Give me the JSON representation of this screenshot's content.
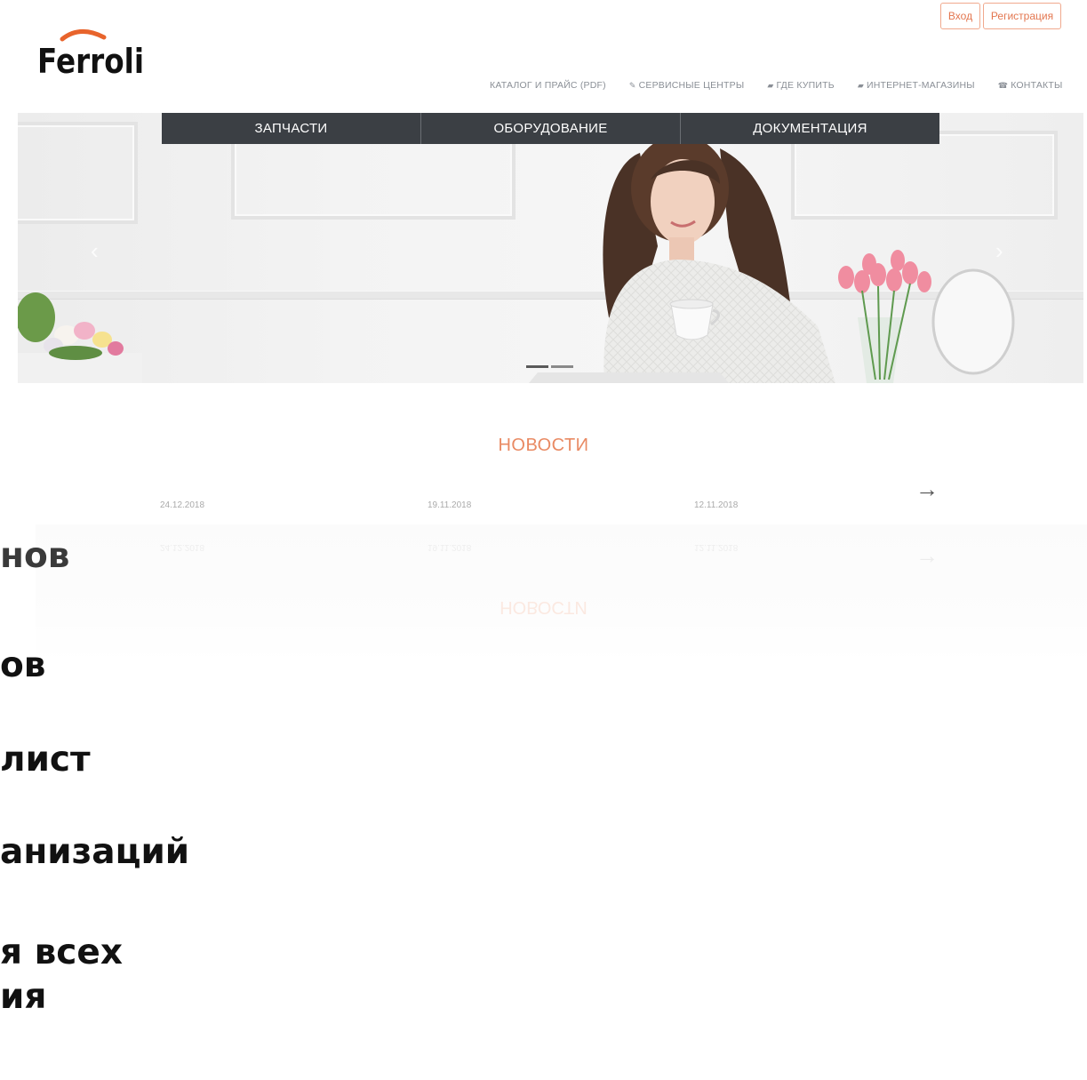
{
  "auth": {
    "login": "Вход",
    "register": "Регистрация"
  },
  "logo": {
    "text": "Ferroli",
    "arc_color": "#e8642c"
  },
  "topnav": [
    {
      "label": "КАТАЛОГ И ПРАЙС (PDF)",
      "icon": ""
    },
    {
      "label": "СЕРВИСНЫЕ ЦЕНТРЫ",
      "icon": "wrench-icon"
    },
    {
      "label": "ГДЕ КУПИТЬ",
      "icon": "cart-icon"
    },
    {
      "label": "ИНТЕРНЕТ-МАГАЗИНЫ",
      "icon": "cart-icon"
    },
    {
      "label": "КОНТАКТЫ",
      "icon": "phone-icon"
    }
  ],
  "catnav": [
    "ЗАПЧАСТИ",
    "ОБОРУДОВАНИЕ",
    "ДОКУМЕНТАЦИЯ"
  ],
  "slider": {
    "prev": "‹",
    "next": "›"
  },
  "news": {
    "title": "НОВОСТИ",
    "more": "→",
    "dates": [
      "24.12.2018",
      "19.11.2018",
      "12.11.2018"
    ]
  },
  "overlay_lines": [
    "нов",
    "ов",
    "лист",
    "анизаций",
    "я всех",
    "ия"
  ],
  "colors": {
    "accent": "#e98a63",
    "catnav_bg": "#3b3f44",
    "auth_border": "#f0a98e"
  }
}
